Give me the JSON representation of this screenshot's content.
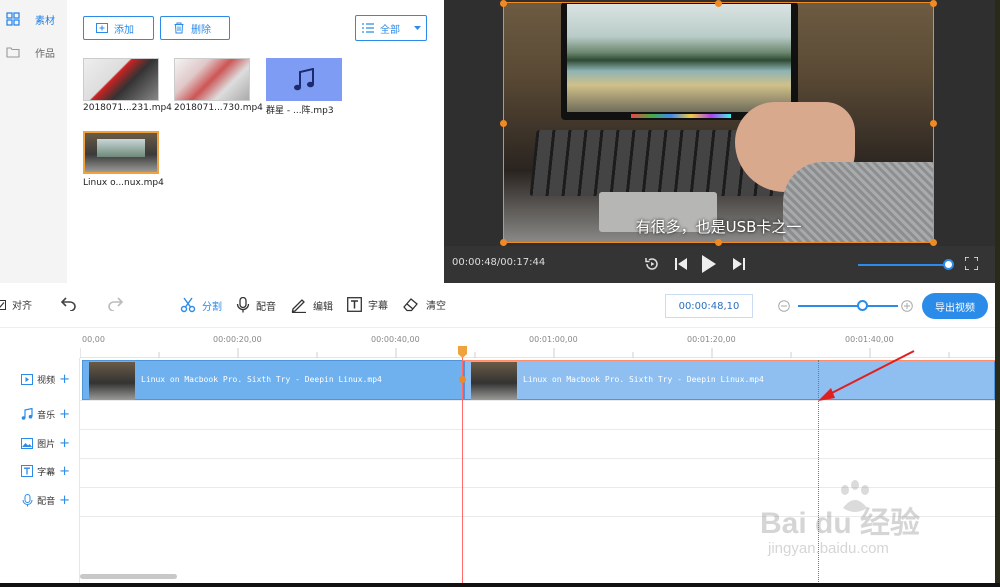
{
  "nav": {
    "items": [
      {
        "label": "素材",
        "icon": "grid-icon",
        "active": true
      },
      {
        "label": "作品",
        "icon": "folder-icon",
        "active": false
      }
    ]
  },
  "media_toolbar": {
    "add_label": "添加",
    "delete_label": "删除",
    "filter_label": "全部"
  },
  "media_items": [
    {
      "label": "2018071...231.mp4"
    },
    {
      "label": "2018071...730.mp4"
    },
    {
      "label": "群星 - ...阵.mp3",
      "icon": "music-note-icon"
    },
    {
      "label": "Linux o...nux.mp4",
      "selected": true
    }
  ],
  "player": {
    "subtitle": "有很多，也是USB卡之一",
    "timecode": "00:00:48/00:17:44"
  },
  "edit_toolbar": {
    "align_label": "对齐",
    "split_label": "分割",
    "dub_label": "配音",
    "edit_label": "编辑",
    "caption_label": "字幕",
    "clear_label": "清空",
    "time_value": "00:00:48,10",
    "export_label": "导出视频"
  },
  "ruler": {
    "ticks": [
      "00,00",
      "00:00:20,00",
      "00:00:40,00",
      "00:01:00,00",
      "00:01:20,00",
      "00:01:40,00"
    ]
  },
  "tracks": [
    {
      "label": "视频",
      "icon": "video-icon"
    },
    {
      "label": "音乐",
      "icon": "music-icon"
    },
    {
      "label": "图片",
      "icon": "image-icon"
    },
    {
      "label": "字幕",
      "icon": "text-icon"
    },
    {
      "label": "配音",
      "icon": "mic-icon"
    }
  ],
  "clips": [
    {
      "title": "Linux on Macbook Pro. Sixth Try - Deepin Linux.mp4"
    },
    {
      "title": "Linux on Macbook Pro. Sixth Try - Deepin Linux.mp4"
    }
  ],
  "watermark": {
    "brand": "Bai du 经验",
    "url": "jingyan.baidu.com"
  },
  "colors": {
    "accent": "#2b8be8",
    "playhead": "#ff6b6b",
    "selection": "#f08a24",
    "clip": "#6fb0ee"
  }
}
